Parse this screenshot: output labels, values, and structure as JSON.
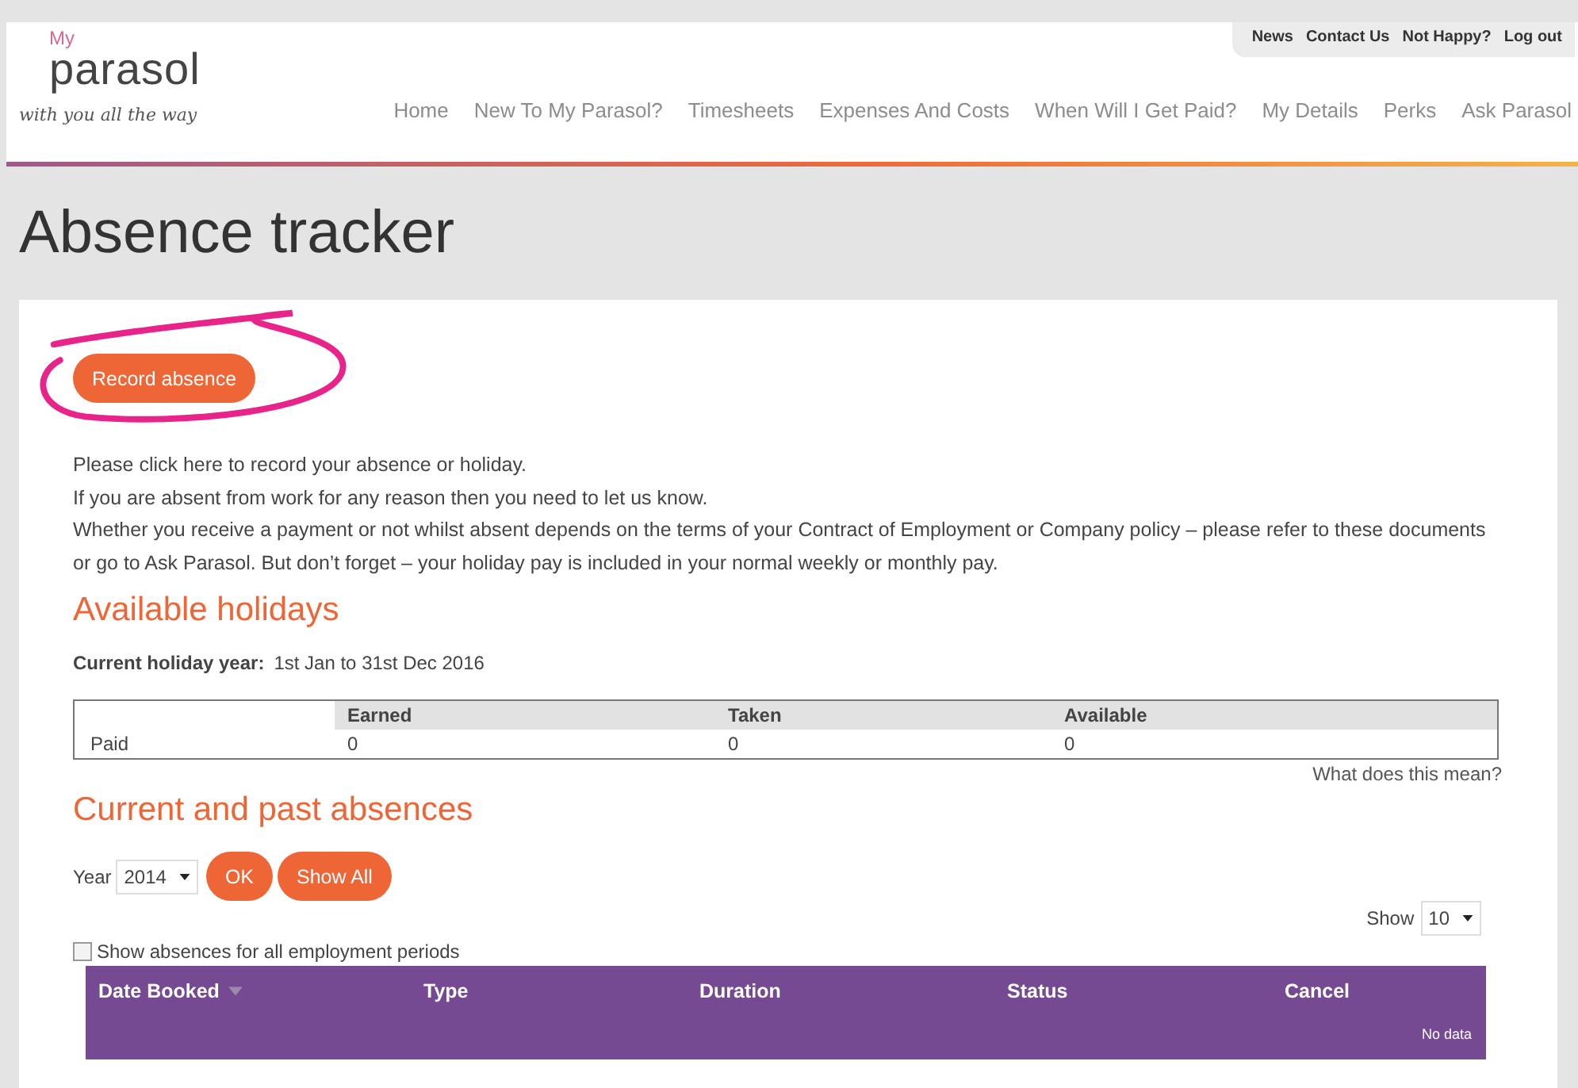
{
  "header": {
    "logo": {
      "prefix": "My",
      "name": "parasol",
      "tagline": "with you all the way"
    },
    "top_links": [
      "News",
      "Contact Us",
      "Not Happy?",
      "Log out"
    ],
    "nav": [
      "Home",
      "New To My Parasol?",
      "Timesheets",
      "Expenses And Costs",
      "When Will I Get Paid?",
      "My Details",
      "Perks",
      "Ask Parasol"
    ]
  },
  "page_title": "Absence tracker",
  "record_button": {
    "label": "Record absence",
    "highlighted": true
  },
  "intro": [
    "Please click here to record your absence or holiday.",
    "If you are absent from work for any reason then you need to let us know.",
    "Whether you receive a payment or not whilst absent depends on the terms of your Contract of Employment or Company policy – please refer to these documents or go to Ask Parasol. But don’t forget – your holiday pay is included in your normal weekly or monthly pay."
  ],
  "available_holidays": {
    "heading": "Available holidays",
    "year_label": "Current holiday year:",
    "year_value": "1st Jan to 31st Dec 2016",
    "columns": [
      "Earned",
      "Taken",
      "Available"
    ],
    "rows": [
      {
        "label": "Paid",
        "values": [
          "0",
          "0",
          "0"
        ]
      }
    ],
    "help_link": "What does this mean?"
  },
  "absences": {
    "heading": "Current and past absences",
    "year_label": "Year",
    "year_value": "2014",
    "ok_button": "OK",
    "show_all_button": "Show All",
    "show_label": "Show",
    "show_value": "10",
    "all_periods": {
      "label": "Show absences for all employment periods",
      "checked": false
    },
    "columns": [
      "Date Booked",
      "Type",
      "Duration",
      "Status",
      "Cancel"
    ],
    "empty_text": "No data"
  }
}
